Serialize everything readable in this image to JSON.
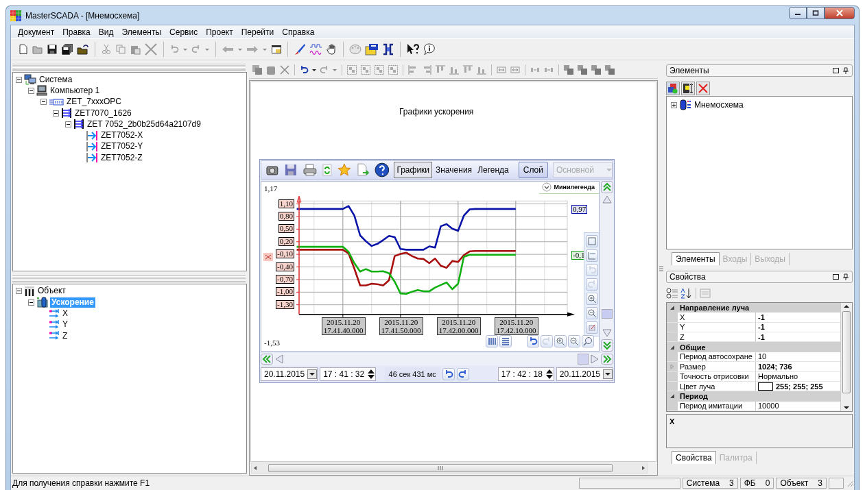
{
  "window": {
    "title": "MasterSCADA - [Мнемосхема]"
  },
  "menu": [
    "Документ",
    "Правка",
    "Вид",
    "Элементы",
    "Сервис",
    "Проект",
    "Перейти",
    "Справка"
  ],
  "system_tree": [
    {
      "label": "Система",
      "kind": "system",
      "expanded": true,
      "selected": false,
      "children": [
        {
          "label": "Компьютер 1",
          "kind": "computer",
          "expanded": true,
          "selected": false,
          "children": [
            {
              "label": "ZET_7xxxOPC",
              "kind": "opc",
              "expanded": true,
              "selected": false,
              "children": [
                {
                  "label": "ZET7070_1626",
                  "kind": "device",
                  "expanded": true,
                  "selected": false,
                  "children": [
                    {
                      "label": "ZET 7052_2b0b25d64a2107d9",
                      "kind": "device",
                      "expanded": true,
                      "selected": false,
                      "children": [
                        {
                          "label": "ZET7052-X",
                          "kind": "channel",
                          "selected": false
                        },
                        {
                          "label": "ZET7052-Y",
                          "kind": "channel",
                          "selected": false
                        },
                        {
                          "label": "ZET7052-Z",
                          "kind": "channel",
                          "selected": false
                        }
                      ]
                    }
                  ]
                }
              ]
            }
          ]
        }
      ]
    }
  ],
  "object_tree": [
    {
      "label": "Объект",
      "kind": "object",
      "expanded": true,
      "selected": false,
      "children": [
        {
          "label": "Ускорение",
          "kind": "group",
          "expanded": true,
          "selected": true,
          "children": [
            {
              "label": "X",
              "kind": "signal",
              "selected": false
            },
            {
              "label": "Y",
              "kind": "signal",
              "selected": false
            },
            {
              "label": "Z",
              "kind": "signal",
              "selected": false
            }
          ]
        }
      ]
    }
  ],
  "canvas": {
    "title": "Графики ускорения",
    "trend": {
      "toolbar_tabs": [
        {
          "label": "Графики",
          "selected": true
        },
        {
          "label": "Значения",
          "selected": false
        },
        {
          "label": "Легенда",
          "selected": false
        }
      ],
      "layer_button": "Слой",
      "layer_select": {
        "value": "Основной",
        "disabled": true
      },
      "minilegend": "Минилегенда",
      "top_value": "1,17",
      "bottom_value": "-1,53",
      "value_tags": [
        {
          "text": "0,97",
          "color": "#0a14a8"
        },
        {
          "text": "-0,1",
          "color": "#10a010"
        }
      ],
      "chart_data": {
        "type": "line",
        "categories": [
          null,
          null,
          null,
          null,
          null,
          null,
          null,
          null,
          "2015.11.20 17.41.40.000",
          null,
          null,
          null,
          null,
          null,
          null,
          null,
          null,
          null,
          "2015.11.20 17.41.50.000",
          null,
          null,
          null,
          null,
          null,
          null,
          null,
          null,
          null,
          "2015.11.20 17.42.00.000",
          null,
          null,
          null,
          null,
          null,
          null,
          null,
          null,
          null,
          "2015.11.20 17.42.10.000"
        ],
        "series": [
          {
            "color": "#0a14a8",
            "values": [
              0.98,
              0.98,
              0.98,
              0.98,
              0.98,
              0.98,
              0.98,
              0.98,
              0.98,
              1.05,
              0.82,
              0.35,
              0.21,
              0.1,
              0.15,
              0.24,
              0.34,
              0.31,
              0.03,
              0.01,
              0.01,
              0.01,
              0.01,
              0.09,
              0.06,
              0.57,
              0.62,
              0.51,
              0.46,
              0.82,
              0.97,
              0.98,
              0.98,
              0.98,
              0.98,
              0.98,
              0.98,
              0.98,
              0.98
            ]
          },
          {
            "color": "#a81010",
            "values": [
              0.01,
              0.01,
              0.01,
              0.01,
              0.01,
              0.01,
              0.01,
              0.01,
              0.01,
              -0.08,
              -0.44,
              -0.84,
              -0.84,
              -0.8,
              -0.81,
              -0.84,
              -0.72,
              -0.14,
              -0.09,
              -0.06,
              -0.14,
              -0.2,
              -0.21,
              -0.31,
              -0.2,
              -0.37,
              -0.42,
              -0.26,
              -0.28,
              -0.12,
              -0.03,
              -0.02,
              -0.02,
              -0.02,
              -0.02,
              -0.02,
              -0.02,
              -0.02,
              -0.02
            ]
          },
          {
            "color": "#10b010",
            "values": [
              0.08,
              0.08,
              0.08,
              0.08,
              0.08,
              0.08,
              0.08,
              0.08,
              0.08,
              -0.04,
              -0.31,
              -0.51,
              -0.45,
              -0.51,
              -0.51,
              -0.5,
              -0.55,
              -0.75,
              -1.03,
              -1.04,
              -0.99,
              -0.95,
              -0.98,
              -0.98,
              -0.89,
              -0.83,
              -0.77,
              -0.93,
              -0.8,
              -0.16,
              -0.11,
              -0.11,
              -0.11,
              -0.11,
              -0.11,
              -0.11,
              -0.11,
              -0.11,
              -0.11
            ]
          }
        ],
        "grid": true,
        "ylim": [
          -1.53,
          1.17
        ],
        "yticks": [
          {
            "value": 1.1,
            "label": "1,10"
          },
          {
            "value": 0.8,
            "label": "0,80"
          },
          {
            "value": 0.5,
            "label": "0,50"
          },
          {
            "value": 0.2,
            "label": "0,20"
          },
          {
            "value": -0.1,
            "label": "-0,10"
          },
          {
            "value": -0.4,
            "label": "-0,40"
          },
          {
            "value": -0.7,
            "label": "-0,70"
          },
          {
            "value": -1.0,
            "label": "-1,00"
          },
          {
            "value": -1.3,
            "label": "-1,30"
          }
        ]
      },
      "from_date": "20.11.2015",
      "from_time": "17 : 41 : 32",
      "duration": "46 сек 431 мс",
      "to_time": "17 : 42 : 18",
      "to_date": "20.11.2015"
    }
  },
  "elements_panel": {
    "title": "Элементы",
    "tree": [
      {
        "label": "Мнемосхема",
        "kind": "scheme",
        "expanded": false,
        "selected": false
      }
    ],
    "tabs": [
      {
        "label": "Элементы",
        "selected": true
      },
      {
        "label": "Входы",
        "selected": false
      },
      {
        "label": "Выходы",
        "selected": false
      }
    ]
  },
  "properties_panel": {
    "title": "Свойства",
    "groups": [
      {
        "name": "Направление луча",
        "expanded": true,
        "rows": [
          {
            "name": "X",
            "value": "-1",
            "bold": true
          },
          {
            "name": "Y",
            "value": "-1",
            "bold": true
          },
          {
            "name": "Z",
            "value": "-1",
            "bold": true
          }
        ]
      },
      {
        "name": "Общие",
        "expanded": true,
        "rows": [
          {
            "name": "Период автосохране",
            "value": "10",
            "bold": false
          },
          {
            "name": "Размер",
            "value": "1024; 736",
            "bold": true,
            "expanded": false
          },
          {
            "name": "Точность отрисовки",
            "value": "Нормально",
            "bold": false
          },
          {
            "name": "Цвет луча",
            "value": "255; 255; 255",
            "bold": true,
            "color": "#ffffff"
          }
        ]
      },
      {
        "name": "Период",
        "expanded": true,
        "rows": [
          {
            "name": "Период имитации",
            "value": "10000",
            "bold": false
          }
        ]
      }
    ],
    "description": "X",
    "tabs": [
      {
        "label": "Свойства",
        "selected": true
      },
      {
        "label": "Палитра",
        "selected": false
      }
    ]
  },
  "status_bar": {
    "message": "Для получения справки нажмите F1",
    "counters": [
      {
        "label": "Система",
        "count": "3"
      },
      {
        "label": "ФБ",
        "count": "0"
      },
      {
        "label": "Объект",
        "count": "3"
      }
    ]
  }
}
